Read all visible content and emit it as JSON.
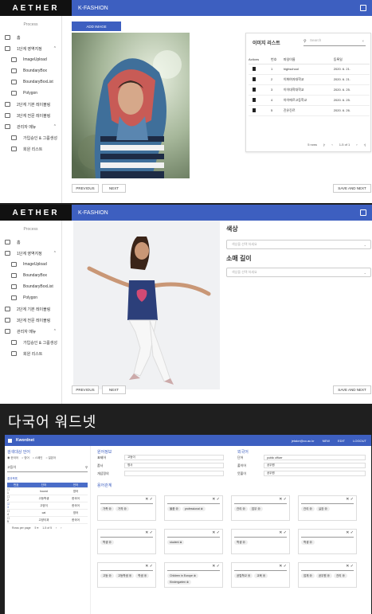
{
  "app": {
    "logo": "AETHER",
    "title": "K-FASHION"
  },
  "sidebar": {
    "process": "Process",
    "items": [
      {
        "label": "홈"
      },
      {
        "label": "1단계 영역지정"
      },
      {
        "label": "ImageUpload"
      },
      {
        "label": "BoundaryBox"
      },
      {
        "label": "BoundaryBoxList"
      },
      {
        "label": "Polygon"
      },
      {
        "label": "2단계 기본 레이블링"
      },
      {
        "label": "3단계 전문 레이블링"
      },
      {
        "label": "관리자 메뉴"
      },
      {
        "label": "가입승인 & 그룹생성"
      },
      {
        "label": "회원 리스트"
      }
    ]
  },
  "screen1": {
    "add_image": "ADD IMAGE",
    "list_title": "이미지 리스트",
    "search_placeholder": "Search",
    "columns": [
      "Actions",
      "번호",
      "파일이름",
      "등록일"
    ],
    "rows": [
      {
        "no": "1",
        "file": "highschool",
        "date": "2020. 6. 21."
      },
      {
        "no": "2",
        "file": "이화여자대학교",
        "date": "2020. 6. 21."
      },
      {
        "no": "3",
        "file": "이이대학대학교",
        "date": "2020. 6. 25."
      },
      {
        "no": "4",
        "file": "아이에르고등학교",
        "date": "2020. 6. 25."
      },
      {
        "no": "5",
        "file": "진유진르",
        "date": "2020. 6. 26."
      }
    ],
    "rows_label": "5 rows",
    "page_info": "1-5 of 1",
    "prev": "PREVIOUS",
    "next": "NEXT",
    "save": "SAVE AND NEXT"
  },
  "screen2": {
    "color_label": "색상",
    "color_placeholder": "색상을 선택 하세요",
    "sleeve_label": "소매 길이",
    "sleeve_placeholder": "색상을 선택 하세요",
    "prev": "PREVIOUS",
    "next": "NEXT",
    "save": "SAVE AND NEXT"
  },
  "wordnet": {
    "section_title": "다국어 워드넷",
    "brand": "Kwordnet",
    "user": "jetake@co.ac.kr",
    "menu": [
      "NEW",
      "EDIT",
      "LOGOUT"
    ],
    "search_title": "검색대상 언어",
    "radio_options": [
      "한국어",
      "영어",
      "스페인",
      "일본어"
    ],
    "search_value": "고등이",
    "result_label": "결과목록",
    "table_headers": [
      "번호",
      "단어",
      "언어"
    ],
    "table_rows": [
      {
        "no": "1",
        "word": "hound",
        "lang": "영어"
      },
      {
        "no": "2",
        "word": "고등학생",
        "lang": "한국어"
      },
      {
        "no": "3",
        "word": "고양이",
        "lang": "한국어"
      },
      {
        "no": "4",
        "word": "cat",
        "lang": "영어"
      },
      {
        "no": "5",
        "word": "고양이과",
        "lang": "한국어"
      }
    ],
    "rows_per_page": "Rows per page",
    "page_info": "1-5 of 5",
    "source_title": "원어정보",
    "target_title": "외국어",
    "src_fields": [
      {
        "label": "표제어",
        "value": "고등이"
      },
      {
        "label": "품사",
        "value": "명사"
      },
      {
        "label": "개념정의",
        "value": ""
      }
    ],
    "tgt_fields": [
      {
        "label": "단어",
        "value": "public officer"
      },
      {
        "label": "풀이어",
        "value": "공무원"
      },
      {
        "label": "뜻풀이",
        "value": "공무원"
      }
    ],
    "relation_title": "용어관계",
    "relation_chips": [
      [
        "가족",
        "가격"
      ],
      [
        "물품",
        "professional"
      ],
      [
        "관리",
        "업무"
      ],
      [
        "관리",
        "실장"
      ],
      [
        "학생"
      ],
      [
        "student"
      ],
      [
        "학생"
      ],
      [
        "학생"
      ],
      [
        "고등",
        "고등학생",
        "학생"
      ],
      [
        "Children in Europe",
        "Kindergarten"
      ],
      [
        "공립학교",
        "교육"
      ],
      [
        "업체",
        "공무원",
        "관리"
      ]
    ]
  }
}
